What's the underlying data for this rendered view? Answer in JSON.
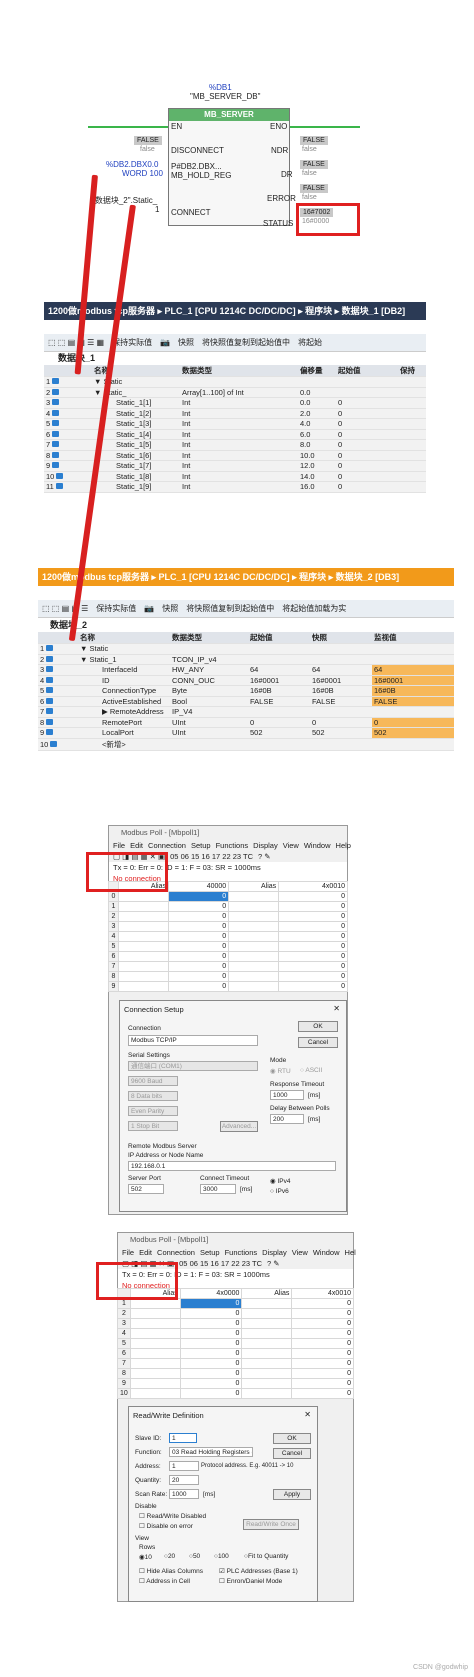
{
  "block": {
    "db_name": "%DB1",
    "db_sub": "\"MB_SERVER_DB\"",
    "block_title": "MB_SERVER",
    "en": "EN",
    "eno": "ENO",
    "disconnect": "DISCONNECT",
    "hold_reg": "MB_HOLD_REG",
    "connect": "CONNECT",
    "ndr": "NDR",
    "dr": "DR",
    "error": "ERROR",
    "status": "STATUS",
    "false_in": "FALSE",
    "false_sub": "false",
    "db2_ref": "%DB2.DBX0.0",
    "db2_word": "WORD 100",
    "pdb2": "P#DB2.DBX...",
    "static_ref": "\"数据块_2\".Static_",
    "one": "1",
    "ndr_val": "FALSE",
    "ndr_sub": "false",
    "dr_val": "FALSE",
    "dr_sub": "false",
    "err_val": "FALSE",
    "err_sub": "false",
    "status_val": "16#7002",
    "status_sub": "16#0000"
  },
  "db1": {
    "breadcrumb": "1200做modbus tcp服务器 ▸ PLC_1 [CPU 1214C DC/DC/DC] ▸ 程序块 ▸ 数据块_1 [DB2]",
    "toolbar": [
      "保持实际值",
      "快照",
      "将快照值复制到起始值中",
      "将起始"
    ],
    "title": "数据块_1",
    "headers": [
      "名称",
      "数据类型",
      "偏移量",
      "起始值",
      "保持"
    ],
    "rows": [
      [
        "1",
        "▼ Static",
        "",
        "",
        ""
      ],
      [
        "2",
        "▼ Static_",
        "Array[1..100] of Int",
        "0.0",
        ""
      ],
      [
        "3",
        "Static_1[1]",
        "Int",
        "0.0",
        "0"
      ],
      [
        "4",
        "Static_1[2]",
        "Int",
        "2.0",
        "0"
      ],
      [
        "5",
        "Static_1[3]",
        "Int",
        "4.0",
        "0"
      ],
      [
        "6",
        "Static_1[4]",
        "Int",
        "6.0",
        "0"
      ],
      [
        "7",
        "Static_1[5]",
        "Int",
        "8.0",
        "0"
      ],
      [
        "8",
        "Static_1[6]",
        "Int",
        "10.0",
        "0"
      ],
      [
        "9",
        "Static_1[7]",
        "Int",
        "12.0",
        "0"
      ],
      [
        "10",
        "Static_1[8]",
        "Int",
        "14.0",
        "0"
      ],
      [
        "11",
        "Static_1[9]",
        "Int",
        "16.0",
        "0"
      ]
    ]
  },
  "db2": {
    "breadcrumb": "1200做modbus tcp服务器 ▸ PLC_1 [CPU 1214C DC/DC/DC] ▸ 程序块 ▸ 数据块_2 [DB3]",
    "toolbar": [
      "保持实际值",
      "快照",
      "将快照值复制到起始值中",
      "将起始值加载为实"
    ],
    "title": "数据块_2",
    "headers": [
      "名称",
      "数据类型",
      "起始值",
      "快照",
      "监视值"
    ],
    "rows": [
      [
        "1",
        "▼ Static",
        "",
        "",
        "",
        ""
      ],
      [
        "2",
        "▼ Static_1",
        "TCON_IP_v4",
        "",
        "",
        ""
      ],
      [
        "3",
        "InterfaceId",
        "HW_ANY",
        "64",
        "64",
        "64"
      ],
      [
        "4",
        "ID",
        "CONN_OUC",
        "16#0001",
        "16#0001",
        "16#0001"
      ],
      [
        "5",
        "ConnectionType",
        "Byte",
        "16#0B",
        "16#0B",
        "16#0B"
      ],
      [
        "6",
        "ActiveEstablished",
        "Bool",
        "FALSE",
        "FALSE",
        "FALSE"
      ],
      [
        "7",
        "▶ RemoteAddress",
        "IP_V4",
        "",
        "",
        ""
      ],
      [
        "8",
        "RemotePort",
        "UInt",
        "0",
        "0",
        "0"
      ],
      [
        "9",
        "LocalPort",
        "UInt",
        "502",
        "502",
        "502"
      ],
      [
        "10",
        "<新增>",
        "",
        "",
        "",
        ""
      ]
    ]
  },
  "poll1": {
    "title": "Modbus Poll - [Mbpoll1]",
    "menu": [
      "File",
      "Edit",
      "Connection",
      "Setup",
      "Functions",
      "Display",
      "View",
      "Window",
      "Help"
    ],
    "toolbar_codes": "05 06 15 16 17 22 23 TC",
    "status": "Tx = 0: Err = 0: ID = 1: F = 03: SR = 1000ms",
    "noconn": "No connection",
    "col_alias": "Alias",
    "col_addr": "40000",
    "col_alias2": "Alias",
    "col_addr2": "4x0010",
    "rows": [
      "0",
      "1",
      "2",
      "3",
      "4",
      "5",
      "6",
      "7",
      "8",
      "9"
    ],
    "val": "0",
    "dialog": {
      "title": "Connection Setup",
      "close": "✕",
      "connection_label": "Connection",
      "connection_value": "Modbus TCP/IP",
      "serial_label": "Serial Settings",
      "port": "通信端口 (COM1)",
      "baud": "9600 Baud",
      "bits": "8 Data bits",
      "parity": "Even Parity",
      "stop": "1 Stop Bit",
      "advanced": "Advanced...",
      "mode_label": "Mode",
      "rtu": "RTU",
      "ascii": "ASCII",
      "resp_label": "Response Timeout",
      "resp_val": "1000",
      "resp_unit": "[ms]",
      "delay_label": "Delay Between Polls",
      "delay_val": "200",
      "delay_unit": "[ms]",
      "remote_label": "Remote Modbus Server",
      "ip_label": "IP Address or Node Name",
      "ip_val": "192.168.0.1",
      "port_label": "Server Port",
      "port_val": "502",
      "timeout_label": "Connect Timeout",
      "timeout_val": "3000",
      "timeout_unit": "[ms]",
      "ipv4": "IPv4",
      "ipv6": "IPv6",
      "ok": "OK",
      "cancel": "Cancel"
    }
  },
  "poll2": {
    "title": "Modbus Poll - [Mbpoll1]",
    "menu": [
      "File",
      "Edit",
      "Connection",
      "Setup",
      "Functions",
      "Display",
      "View",
      "Window",
      "Hel"
    ],
    "toolbar_codes": "05 06 15 16 17 22 23 TC",
    "status": "Tx = 0: Err = 0: ID = 1: F = 03: SR = 1000ms",
    "noconn": "No connection",
    "col_alias": "Alias",
    "col_addr": "4x0000",
    "col_alias2": "Alias",
    "col_addr2": "4x0010",
    "rows": [
      "1",
      "2",
      "3",
      "4",
      "5",
      "6",
      "7",
      "8",
      "9",
      "10"
    ],
    "val": "0",
    "dialog": {
      "title": "Read/Write Definition",
      "close": "✕",
      "slave_label": "Slave ID:",
      "slave_val": "1",
      "func_label": "Function:",
      "func_val": "03 Read Holding Registers (4x)",
      "addr_label": "Address:",
      "addr_val": "1",
      "addr_hint": "Protocol address. E.g. 40011 -> 10",
      "qty_label": "Quantity:",
      "qty_val": "20",
      "scan_label": "Scan Rate:",
      "scan_val": "1000",
      "scan_unit": "[ms]",
      "disable_label": "Disable",
      "rw_disabled": "Read/Write Disabled",
      "disable_err": "Disable on error",
      "rw_once": "Read/Write Once",
      "view_label": "View",
      "rows_label": "Rows",
      "r10": "10",
      "r20": "20",
      "r50": "50",
      "r100": "100",
      "fit": "Fit to Quantity",
      "hide_alias": "Hide Alias Columns",
      "plc_addr": "PLC Addresses (Base 1)",
      "addr_cell": "Address in Cell",
      "enron": "Enron/Daniel Mode",
      "ok": "OK",
      "cancel": "Cancel",
      "apply": "Apply"
    }
  },
  "watermark": "CSDN @godwhip",
  "colors": {
    "tia_bar": "#2b3a55",
    "tia_bar2": "#f29a1a",
    "green": "#3ab54a",
    "red": "#e02020",
    "orange_cell": "#f7b85a"
  }
}
